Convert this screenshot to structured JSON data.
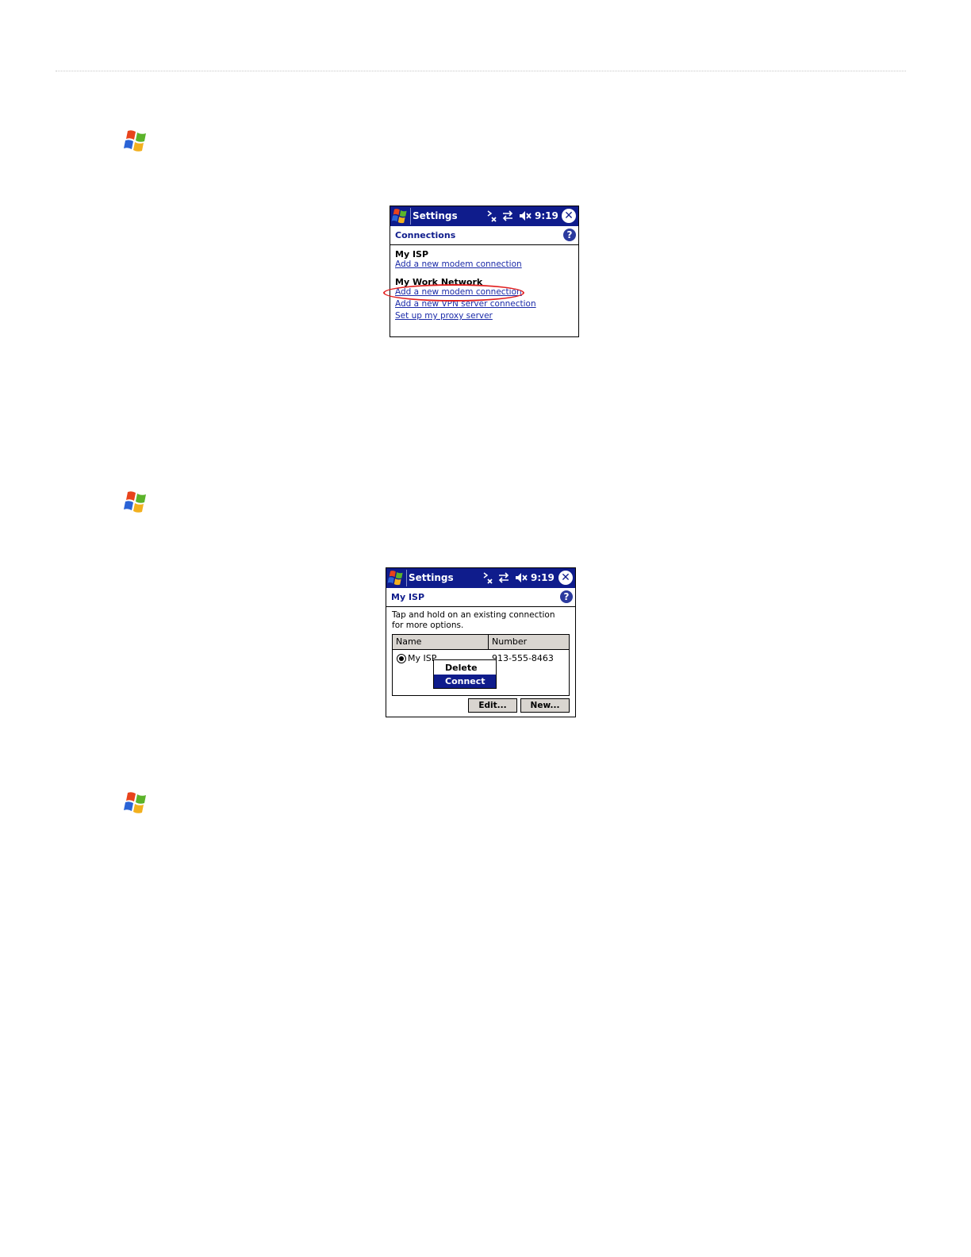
{
  "screen1": {
    "title": "Settings",
    "time": "9:19",
    "header": "Connections",
    "group1_label": "My ISP",
    "group1_link": "Add a new modem connection",
    "group2_label": "My Work Network",
    "group2_links": [
      "Add a new modem connection",
      "Add a new VPN server connection",
      "Set up my proxy server"
    ],
    "highlight_color": "#e21f1f"
  },
  "screen2": {
    "title": "Settings",
    "time": "9:19",
    "header": "My ISP",
    "instructions": "Tap and hold on an existing connection for more options.",
    "columns": [
      "Name",
      "Number"
    ],
    "row": {
      "name": "My ISP",
      "number": "913-555-8463"
    },
    "context_menu": [
      "Delete",
      "Connect"
    ],
    "buttons": {
      "edit": "Edit...",
      "new": "New..."
    }
  },
  "icons": {
    "start": "windows-flag-icon",
    "signal": "connectivity-icon",
    "sync": "sync-arrows-icon",
    "volume": "speaker-muted-icon",
    "close": "close-icon",
    "help": "help-icon"
  },
  "colors": {
    "titlebar": "#0f1c8c",
    "link": "#1a2aa8",
    "menu_selected": "#0f1c8c"
  }
}
